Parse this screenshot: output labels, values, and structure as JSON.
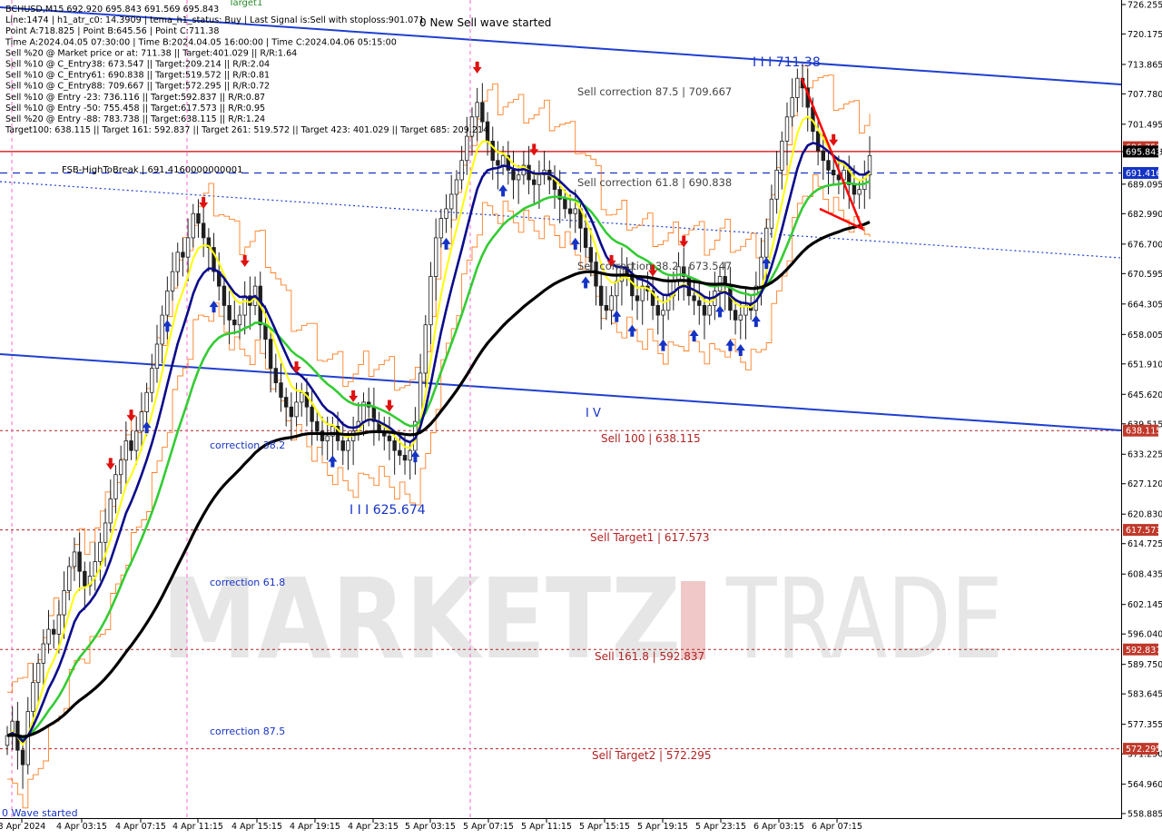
{
  "info_lines": [
    "BCHUSD,M15  692.920 695.843 691.569 695.843",
    "Line:1474  |  h1_atr_c0: 14.3909  |  tema_h1_status: Buy  |  Last Signal is:Sell with stoploss:901.071",
    "Point A:718.825  |  Point B:645.56  |  Point C:711.38",
    "Time A:2024.04.05 07:30:00  |  Time B:2024.04.05 16:00:00  |  Time C:2024.04.06 05:15:00",
    "Sell %20 @ Market price or at: 711.38  ||  Target:401.029  ||  R/R:1.64",
    "Sell %10 @ C_Entry38: 673.547  ||  Target:209.214  ||  R/R:2.04",
    "Sell %10 @ C_Entry61: 690.838  ||  Target:519.572  ||  R/R:0.81",
    "Sell %10 @ C_Entry88: 709.667  ||  Target:572.295  ||  R/R:0.72",
    "Sell %10 @ Entry -23: 736.116  ||  Target:592.837  ||  R/R:0.87",
    "Sell %10 @ Entry -50: 755.458  ||  Target:617.573  ||  R/R:0.95",
    "Sell %20 @ Entry -88: 783.738  ||  Target:638.115  ||  R/R:1.24",
    "Target100: 638.115  ||  Target 161: 592.837  ||  Target 261: 519.572  ||  Target 423: 401.029  ||  Target 685: 209.214"
  ],
  "watermark": {
    "left": "MARKETZ",
    "right": "TRADE"
  },
  "level_labels": {
    "wave_started": "0 New Sell wave started",
    "corr875": "Sell correction 87.5 | 709.667",
    "corr618": "Sell correction 61.8 | 690.838",
    "corr382": "Sell correction 38.2 | 673.547",
    "sell100": "Sell 100 | 638.115",
    "target1": "Sell Target1 | 617.573",
    "sell1618": "Sell 161.8 | 592.837",
    "target2": "Sell Target2 | 572.295",
    "fsb": "FSB-HighToBreak  |  691.4160000000001",
    "point_c": "I I I 711.38",
    "point_b": "I V",
    "point_iii": "I I I 625.674",
    "left_corr382": "correction 38.2",
    "left_corr618": "correction 61.8",
    "left_corr875": "correction 87.5",
    "left_wave": "0 Wave started",
    "top_target": "Target1"
  },
  "price_badges": {
    "current": "695.843",
    "fsb": "691.416",
    "sell100": "638.115",
    "target1": "617.573",
    "sell1618": "592.837",
    "target2": "572.295",
    "hidden": "696.750"
  },
  "colors": {
    "background": "#ffffff",
    "bull": "#1e1e1e",
    "bear": "#1e1e1e",
    "ma_black": "#000000",
    "ma_navy": "#0a0a8c",
    "ma_yellow": "#ffff00",
    "ma_green": "#33cc33",
    "channel": "#1f3fd0",
    "target_red": "#b22222",
    "orange": "#ff6a00",
    "badge_red": "#c0392b",
    "badge_blue": "#1533c4"
  },
  "chart_data": {
    "type": "candlestick",
    "symbol": "BCHUSD",
    "timeframe": "M15",
    "ylim": [
      558.885,
      726.255
    ],
    "y_ticks": [
      "726.255",
      "720.175",
      "713.865",
      "707.780",
      "701.495",
      "695.843",
      "689.095",
      "682.990",
      "676.700",
      "670.595",
      "664.305",
      "658.005",
      "651.910",
      "645.620",
      "639.515",
      "633.225",
      "627.120",
      "620.830",
      "614.725",
      "608.435",
      "602.145",
      "596.040",
      "589.750",
      "583.645",
      "577.355",
      "571.250",
      "564.960",
      "558.885"
    ],
    "x_ticks": [
      "3 Apr 2024",
      "4 Apr 03:15",
      "4 Apr 07:15",
      "4 Apr 11:15",
      "4 Apr 15:15",
      "4 Apr 19:15",
      "4 Apr 23:15",
      "5 Apr 03:15",
      "5 Apr 07:15",
      "5 Apr 11:15",
      "5 Apr 15:15",
      "5 Apr 19:15",
      "5 Apr 23:15",
      "6 Apr 03:15",
      "6 Apr 07:15"
    ],
    "levels": {
      "current": 695.843,
      "fsb": 691.416,
      "sell100": 638.115,
      "target1": 617.573,
      "sell1618": 592.837,
      "target2": 572.295
    },
    "closes": [
      575,
      578,
      572,
      569,
      580,
      586,
      590,
      594,
      597,
      596,
      600,
      605,
      610,
      613,
      609,
      606,
      608,
      611,
      615,
      619,
      624,
      629,
      632,
      636,
      634,
      638,
      642,
      646,
      651,
      656,
      662,
      667,
      671,
      675,
      674,
      678,
      683,
      681,
      678,
      676,
      671,
      668,
      664,
      661,
      660,
      662,
      666,
      664,
      668,
      660,
      657,
      651,
      648,
      645,
      643,
      641,
      644,
      646,
      643,
      640,
      638,
      636,
      637,
      639,
      636,
      634,
      636,
      638,
      640,
      644,
      643,
      640,
      638,
      637,
      636,
      634,
      633,
      632,
      634,
      640,
      650,
      660,
      670,
      678,
      682,
      684,
      687,
      690,
      694,
      699,
      703,
      706,
      702,
      698,
      694,
      693,
      695,
      692,
      690,
      691,
      693,
      690,
      689,
      691,
      692,
      690,
      688,
      686,
      684,
      683,
      684,
      680,
      676,
      673,
      668,
      664,
      663,
      666,
      669,
      672,
      670,
      666,
      665,
      668,
      667,
      664,
      662,
      663,
      666,
      669,
      672,
      670,
      666,
      665,
      664,
      662,
      664,
      667,
      670,
      668,
      663,
      661,
      662,
      664,
      663,
      668,
      674,
      680,
      686,
      692,
      698,
      703,
      707,
      711,
      709,
      705,
      700,
      696,
      694,
      692,
      691,
      690,
      692,
      689,
      687,
      688,
      691,
      695
    ]
  }
}
